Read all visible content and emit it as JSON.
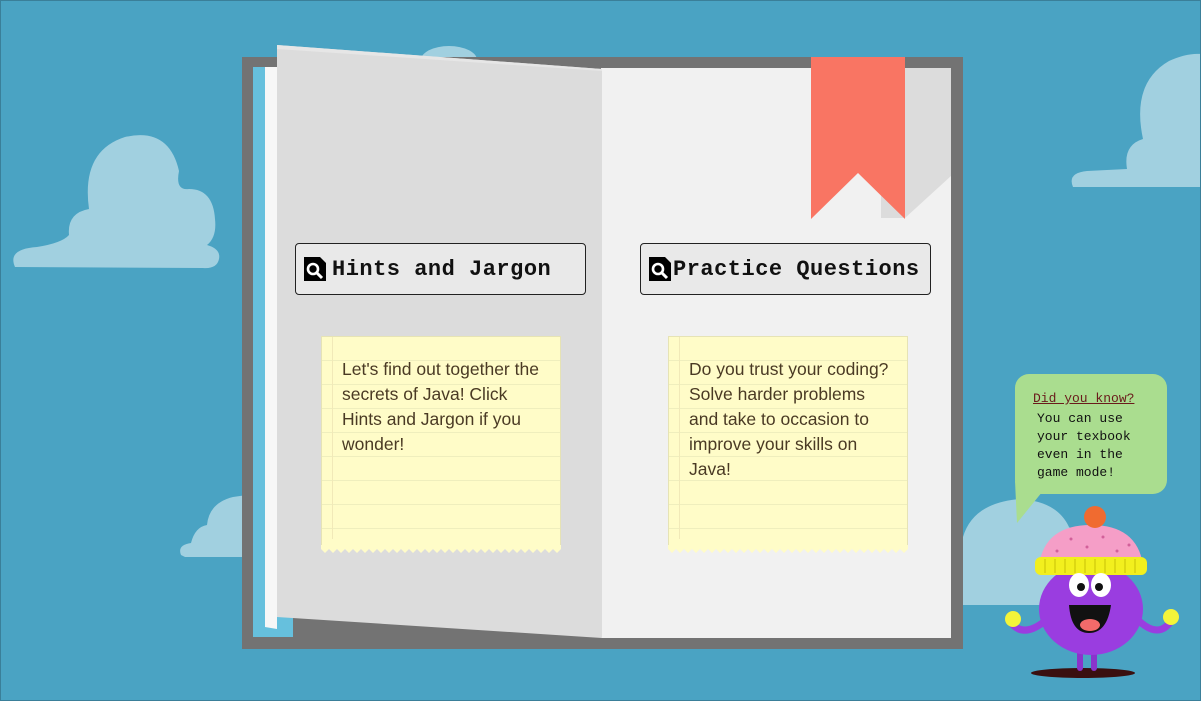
{
  "colors": {
    "sky": "#4aa3c3",
    "cloud": "#a1d0e0",
    "book_cover": "#737373",
    "bookmark": "#f97563",
    "note_paper": "#fffcc8",
    "speech_bubble": "#aadd8f",
    "mascot_body": "#9a3de0"
  },
  "left_page": {
    "button": {
      "icon": "search-icon",
      "label": "Hints and Jargon"
    },
    "note": {
      "text": "Let's find out together the secrets of Java! Click Hints and Jargon if you wonder!"
    }
  },
  "right_page": {
    "button": {
      "icon": "search-icon",
      "label": "Practice Questions"
    },
    "note": {
      "text": "Do you trust your coding? Solve harder problems and take to occasion to improve your skills on Java!"
    }
  },
  "speech_bubble": {
    "title": "Did you know?",
    "text": "You can use your texbook even in the game mode!"
  }
}
